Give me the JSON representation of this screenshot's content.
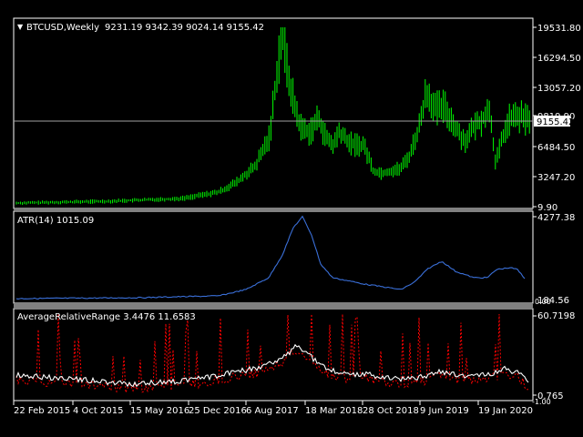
{
  "main_pane": {
    "symbol_label": "BTCUSD,Weekly",
    "ohlc": "9231.19 9342.39 9024.14 9155.42",
    "price_ticks": [
      "19531.80",
      "16294.50",
      "13057.20",
      "9819.90",
      "6484.50",
      "3247.20",
      "9.90"
    ],
    "current_price": "9155.42",
    "bar_color": "#00ff00"
  },
  "atr_pane": {
    "label": "ATR(14) 1015.09",
    "ticks": [
      "4277.38",
      "184.56",
      "0.00"
    ],
    "line_color": "#3a6fd8"
  },
  "arr_pane": {
    "label": "AverageRelativeRange 3.4476 11.6583",
    "ticks": [
      "60.7198",
      "0.765",
      "-1.00"
    ],
    "dotted_color": "#ff0000",
    "line_color": "#ffffff"
  },
  "time_axis": [
    "22 Feb 2015",
    "4 Oct 2015",
    "15 May 2016",
    "25 Dec 2016",
    "6 Aug 2017",
    "18 Mar 2018",
    "28 Oct 2018",
    "9 Jun 2019",
    "19 Jan 2020"
  ],
  "chart_data": [
    {
      "type": "bar",
      "title": "BTCUSD,Weekly",
      "ylim": [
        9.9,
        19531.8
      ],
      "x": [
        "2015",
        "2016",
        "2017-early",
        "2017-peak",
        "2018",
        "2018-late",
        "2019",
        "2020"
      ],
      "values": [
        250,
        430,
        1000,
        19500,
        7000,
        3300,
        13500,
        9155
      ]
    },
    {
      "type": "line",
      "title": "ATR(14) 1015.09",
      "ylim": [
        0,
        4277.38
      ],
      "x": [
        "2015",
        "2016",
        "2017-late",
        "2018",
        "2019",
        "2020"
      ],
      "values": [
        60,
        80,
        4277,
        900,
        1900,
        1015
      ]
    }
  ]
}
